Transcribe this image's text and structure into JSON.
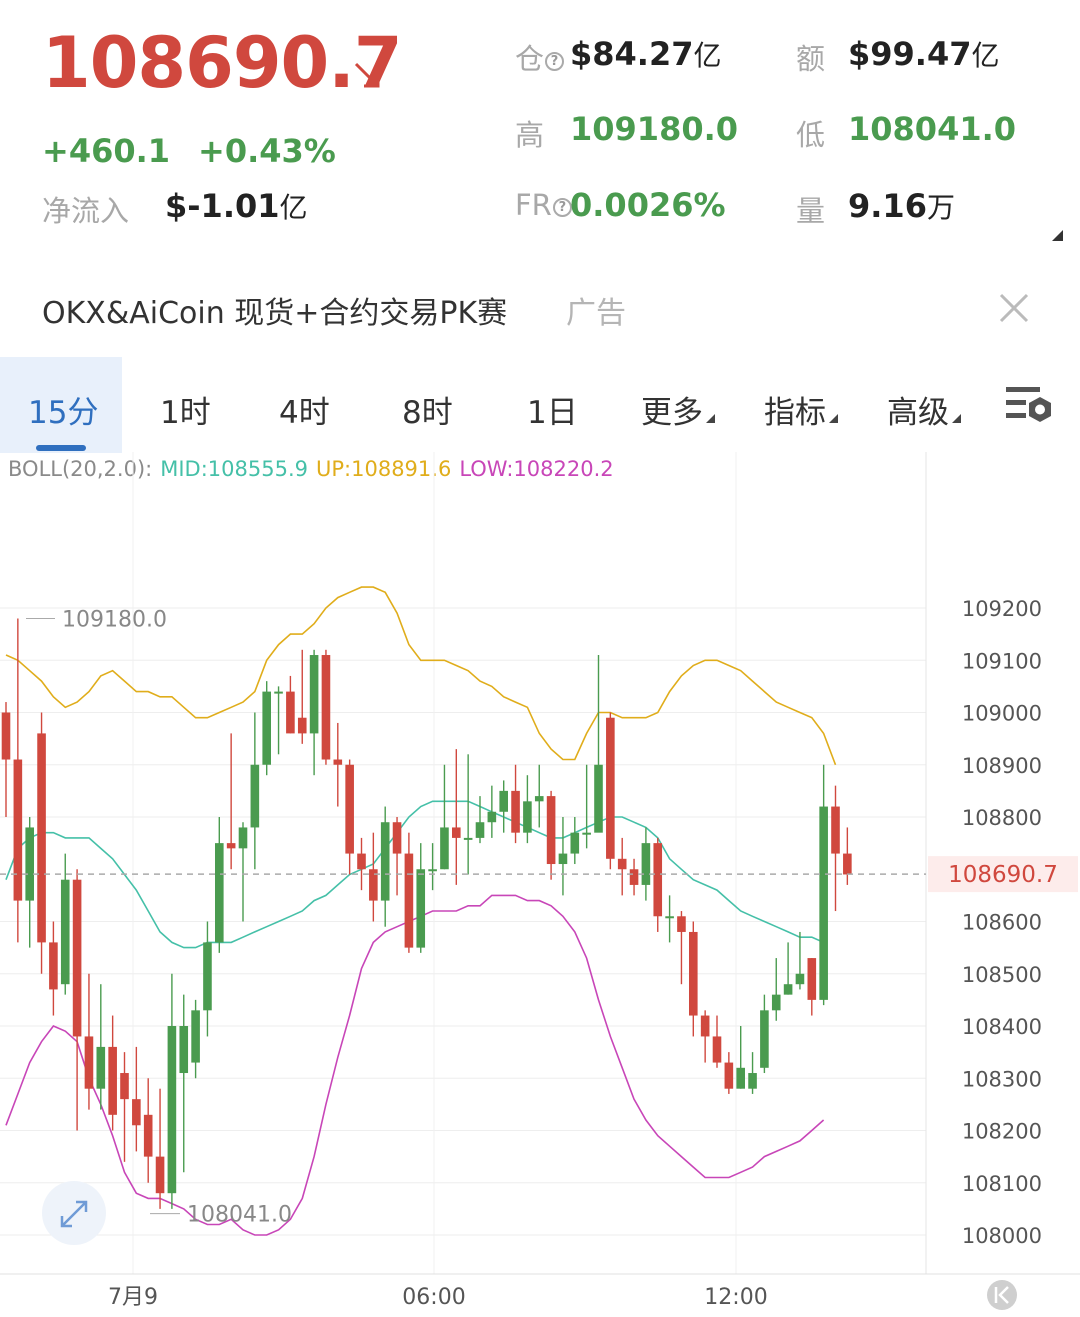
{
  "ticker": {
    "price": "108690.7",
    "change": "+460.1",
    "change_pct": "+0.43%",
    "net_inflow_label": "净流入",
    "net_inflow_value": "$-1.01",
    "net_inflow_unit": "亿"
  },
  "stats": {
    "oi_label": "仓",
    "oi_value": "$84.27",
    "oi_unit": "亿",
    "amount_label": "额",
    "amount_value": "$99.47",
    "amount_unit": "亿",
    "high_label": "高",
    "high_value": "109180.0",
    "low_label": "低",
    "low_value": "108041.0",
    "fr_label": "FR",
    "fr_value": "0.0026%",
    "volume_label": "量",
    "volume_value": "9.16",
    "volume_unit": "万"
  },
  "ad": {
    "text": "OKX&AiCoin 现货+合约交易PK赛",
    "tag": "广告"
  },
  "tabs": [
    "15分",
    "1时",
    "4时",
    "8时",
    "1日",
    "更多",
    "指标",
    "高级"
  ],
  "indicator": {
    "name": "BOLL(20,2.0):",
    "mid": "MID:108555.9",
    "up": "UP:108891.6",
    "low": "LOW:108220.2"
  },
  "colors": {
    "up": "#4a9b4f",
    "down": "#d0483e",
    "accent": "#2f6fbf",
    "boll_mid": "#45c0a8",
    "boll_up": "#e0ad1b",
    "boll_low": "#c846b8"
  },
  "icons": [
    "arrow-down-right-icon",
    "question-icon",
    "close-icon",
    "chart-settings-icon",
    "expand-icon",
    "collapse-left-icon"
  ],
  "chart_data": {
    "type": "candlestick",
    "current_price": 108690.7,
    "current_price_label": "108690.7",
    "high_marker": "109180.0",
    "low_marker": "108041.0",
    "y_ticks": [
      "109200",
      "109100",
      "109000",
      "108900",
      "108800",
      "108600",
      "108500",
      "108400",
      "108300",
      "108200",
      "108100",
      "108000"
    ],
    "x_ticks": [
      "7月9",
      "06:00",
      "12:00"
    ],
    "ylim": [
      107960,
      109290
    ],
    "grid": true,
    "candles": [
      [
        109000,
        108910,
        109020,
        108800
      ],
      [
        108910,
        108640,
        109180,
        108560
      ],
      [
        108640,
        108780,
        108800,
        108550
      ],
      [
        108960,
        108560,
        109000,
        108500
      ],
      [
        108560,
        108470,
        108600,
        108420
      ],
      [
        108480,
        108680,
        108730,
        108460
      ],
      [
        108680,
        108380,
        108700,
        108200
      ],
      [
        108380,
        108280,
        108500,
        108240
      ],
      [
        108280,
        108360,
        108480,
        108240
      ],
      [
        108360,
        108230,
        108420,
        108200
      ],
      [
        108310,
        108260,
        108350,
        108140
      ],
      [
        108260,
        108210,
        108360,
        108160
      ],
      [
        108230,
        108150,
        108300,
        108100
      ],
      [
        108150,
        108080,
        108280,
        108050
      ],
      [
        108080,
        108400,
        108500,
        108050
      ],
      [
        108310,
        108400,
        108460,
        108120
      ],
      [
        108330,
        108430,
        108450,
        108300
      ],
      [
        108430,
        108560,
        108600,
        108380
      ],
      [
        108560,
        108750,
        108800,
        108540
      ],
      [
        108750,
        108740,
        108960,
        108700
      ],
      [
        108740,
        108780,
        108790,
        108600
      ],
      [
        108780,
        108900,
        109000,
        108700
      ],
      [
        108900,
        109040,
        109060,
        108880
      ],
      [
        109040,
        109040,
        109050,
        108920
      ],
      [
        109040,
        108960,
        109070,
        108960
      ],
      [
        108990,
        108960,
        109120,
        108940
      ],
      [
        108960,
        109110,
        109120,
        108880
      ],
      [
        109110,
        108910,
        109120,
        108900
      ],
      [
        108910,
        108900,
        108980,
        108820
      ],
      [
        108900,
        108730,
        108910,
        108690
      ],
      [
        108730,
        108700,
        108760,
        108660
      ],
      [
        108700,
        108640,
        108770,
        108600
      ],
      [
        108640,
        108790,
        108820,
        108590
      ],
      [
        108790,
        108730,
        108800,
        108650
      ],
      [
        108730,
        108550,
        108770,
        108540
      ],
      [
        108550,
        108700,
        108750,
        108540
      ],
      [
        108700,
        108700,
        108750,
        108660
      ],
      [
        108700,
        108780,
        108900,
        108700
      ],
      [
        108780,
        108760,
        108930,
        108670
      ],
      [
        108760,
        108760,
        108920,
        108690
      ],
      [
        108760,
        108790,
        108840,
        108750
      ],
      [
        108790,
        108810,
        108860,
        108760
      ],
      [
        108810,
        108850,
        108870,
        108770
      ],
      [
        108850,
        108770,
        108900,
        108750
      ],
      [
        108770,
        108830,
        108880,
        108750
      ],
      [
        108830,
        108840,
        108900,
        108780
      ],
      [
        108840,
        108710,
        108850,
        108680
      ],
      [
        108710,
        108730,
        108800,
        108650
      ],
      [
        108730,
        108770,
        108800,
        108710
      ],
      [
        108770,
        108770,
        108900,
        108740
      ],
      [
        108770,
        108900,
        109110,
        108800
      ],
      [
        108990,
        108720,
        109000,
        108700
      ],
      [
        108720,
        108700,
        108760,
        108650
      ],
      [
        108700,
        108670,
        108720,
        108650
      ],
      [
        108670,
        108750,
        108780,
        108640
      ],
      [
        108750,
        108610,
        108760,
        108580
      ],
      [
        108610,
        108610,
        108650,
        108560
      ],
      [
        108610,
        108580,
        108620,
        108480
      ],
      [
        108580,
        108420,
        108600,
        108380
      ],
      [
        108420,
        108380,
        108430,
        108330
      ],
      [
        108380,
        108330,
        108420,
        108320
      ],
      [
        108330,
        108280,
        108350,
        108270
      ],
      [
        108280,
        108320,
        108400,
        108280
      ],
      [
        108280,
        108310,
        108350,
        108270
      ],
      [
        108320,
        108430,
        108460,
        108310
      ],
      [
        108430,
        108460,
        108530,
        108410
      ],
      [
        108460,
        108480,
        108560,
        108460
      ],
      [
        108480,
        108500,
        108580,
        108470
      ],
      [
        108530,
        108450,
        108530,
        108420
      ],
      [
        108450,
        108820,
        108900,
        108440
      ],
      [
        108820,
        108730,
        108860,
        108620
      ],
      [
        108730,
        108690,
        108780,
        108670
      ]
    ],
    "boll_up": [
      109110,
      109100,
      109080,
      109060,
      109030,
      109010,
      109020,
      109040,
      109070,
      109080,
      109060,
      109040,
      109040,
      109030,
      109030,
      109010,
      108990,
      108990,
      109000,
      109010,
      109020,
      109040,
      109100,
      109130,
      109150,
      109150,
      109170,
      109200,
      109220,
      109230,
      109240,
      109240,
      109230,
      109190,
      109130,
      109100,
      109100,
      109100,
      109090,
      109080,
      109060,
      109050,
      109030,
      109020,
      109010,
      108960,
      108930,
      108910,
      108910,
      108960,
      109000,
      109000,
      108990,
      108990,
      108990,
      109000,
      109040,
      109070,
      109090,
      109100,
      109100,
      109090,
      109080,
      109060,
      109040,
      109020,
      109010,
      109000,
      108990,
      108960,
      108900
    ],
    "boll_mid": [
      108680,
      108740,
      108760,
      108770,
      108770,
      108760,
      108760,
      108760,
      108740,
      108720,
      108690,
      108660,
      108620,
      108580,
      108560,
      108550,
      108550,
      108560,
      108560,
      108560,
      108570,
      108580,
      108590,
      108600,
      108610,
      108620,
      108640,
      108650,
      108670,
      108690,
      108700,
      108710,
      108740,
      108770,
      108800,
      108820,
      108830,
      108830,
      108830,
      108830,
      108820,
      108810,
      108800,
      108790,
      108780,
      108770,
      108760,
      108760,
      108770,
      108780,
      108790,
      108800,
      108800,
      108790,
      108780,
      108760,
      108720,
      108700,
      108680,
      108670,
      108660,
      108640,
      108620,
      108610,
      108600,
      108590,
      108580,
      108570,
      108570,
      108560
    ],
    "boll_low": [
      108210,
      108270,
      108330,
      108370,
      108400,
      108390,
      108370,
      108300,
      108250,
      108190,
      108120,
      108080,
      108070,
      108070,
      108060,
      108050,
      108030,
      108020,
      108020,
      108030,
      108010,
      108000,
      108000,
      108010,
      108030,
      108070,
      108150,
      108250,
      108340,
      108420,
      108510,
      108560,
      108580,
      108590,
      108600,
      108610,
      108620,
      108620,
      108620,
      108630,
      108630,
      108650,
      108650,
      108650,
      108640,
      108640,
      108630,
      108610,
      108580,
      108530,
      108450,
      108380,
      108320,
      108260,
      108220,
      108190,
      108170,
      108150,
      108130,
      108110,
      108110,
      108110,
      108120,
      108130,
      108150,
      108160,
      108170,
      108180,
      108200,
      108220
    ]
  }
}
